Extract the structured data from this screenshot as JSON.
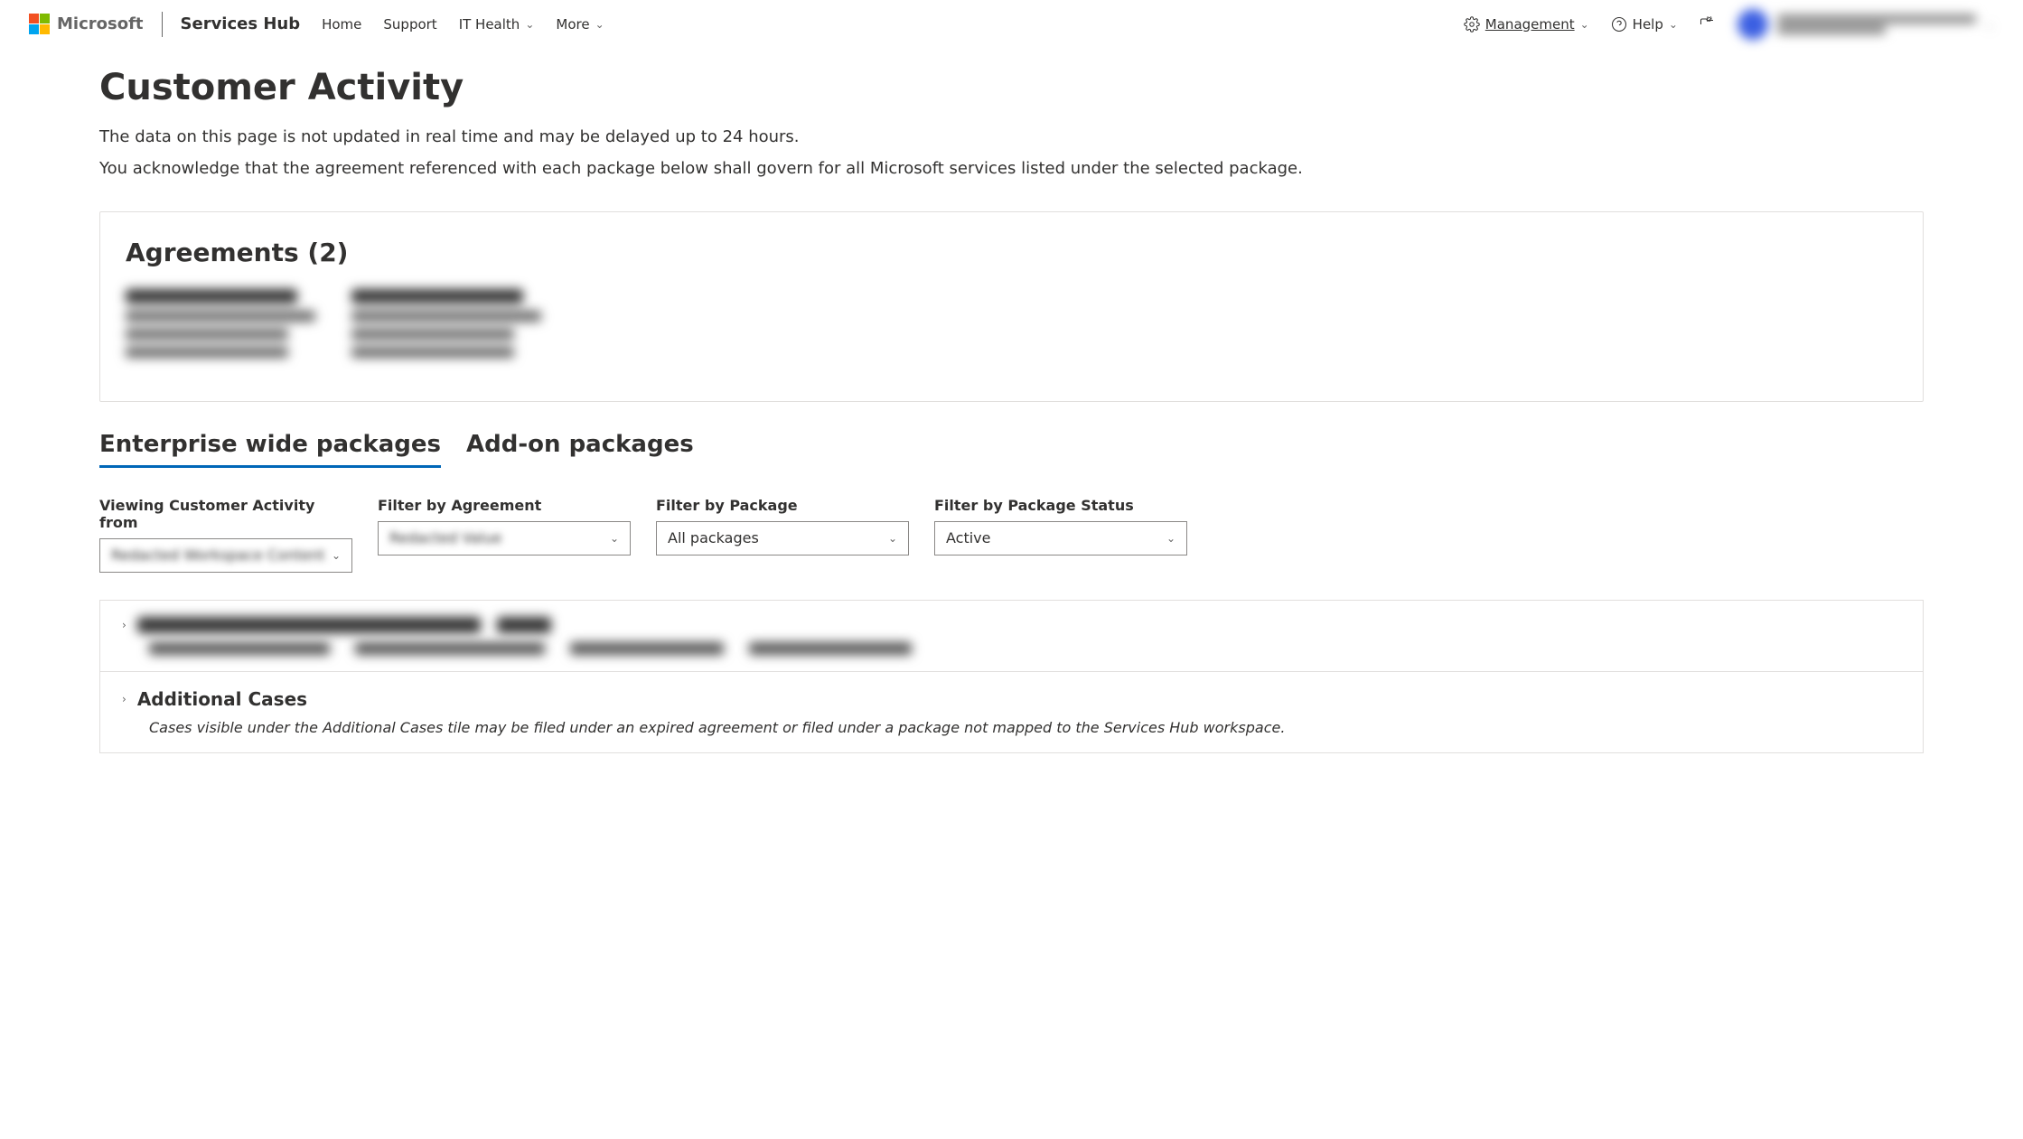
{
  "header": {
    "brand_ms": "Microsoft",
    "brand_app": "Services Hub",
    "nav": {
      "home": "Home",
      "support": "Support",
      "it_health": "IT Health",
      "more": "More",
      "management": "Management",
      "help": "Help"
    }
  },
  "page": {
    "title": "Customer Activity",
    "intro1": "The data on this page is not updated in real time and may be delayed up to 24 hours.",
    "intro2": "You acknowledge that the agreement referenced with each package below shall govern for all Microsoft services listed under the selected package."
  },
  "agreements_card": {
    "title": "Agreements (2)"
  },
  "tabs": {
    "enterprise": "Enterprise wide packages",
    "addon": "Add-on packages"
  },
  "filters": {
    "viewing_from_label": "Viewing Customer Activity from",
    "viewing_from_value": "Redacted Workspace Content",
    "by_agreement_label": "Filter by Agreement",
    "by_agreement_value": "Redacted Value",
    "by_package_label": "Filter by Package",
    "by_package_value": "All packages",
    "by_status_label": "Filter by Package Status",
    "by_status_value": "Active"
  },
  "packages": {
    "additional_cases_title": "Additional Cases",
    "additional_cases_note": "Cases visible under the Additional Cases tile may be filed under an expired agreement or filed under a package not mapped to the Services Hub workspace."
  }
}
